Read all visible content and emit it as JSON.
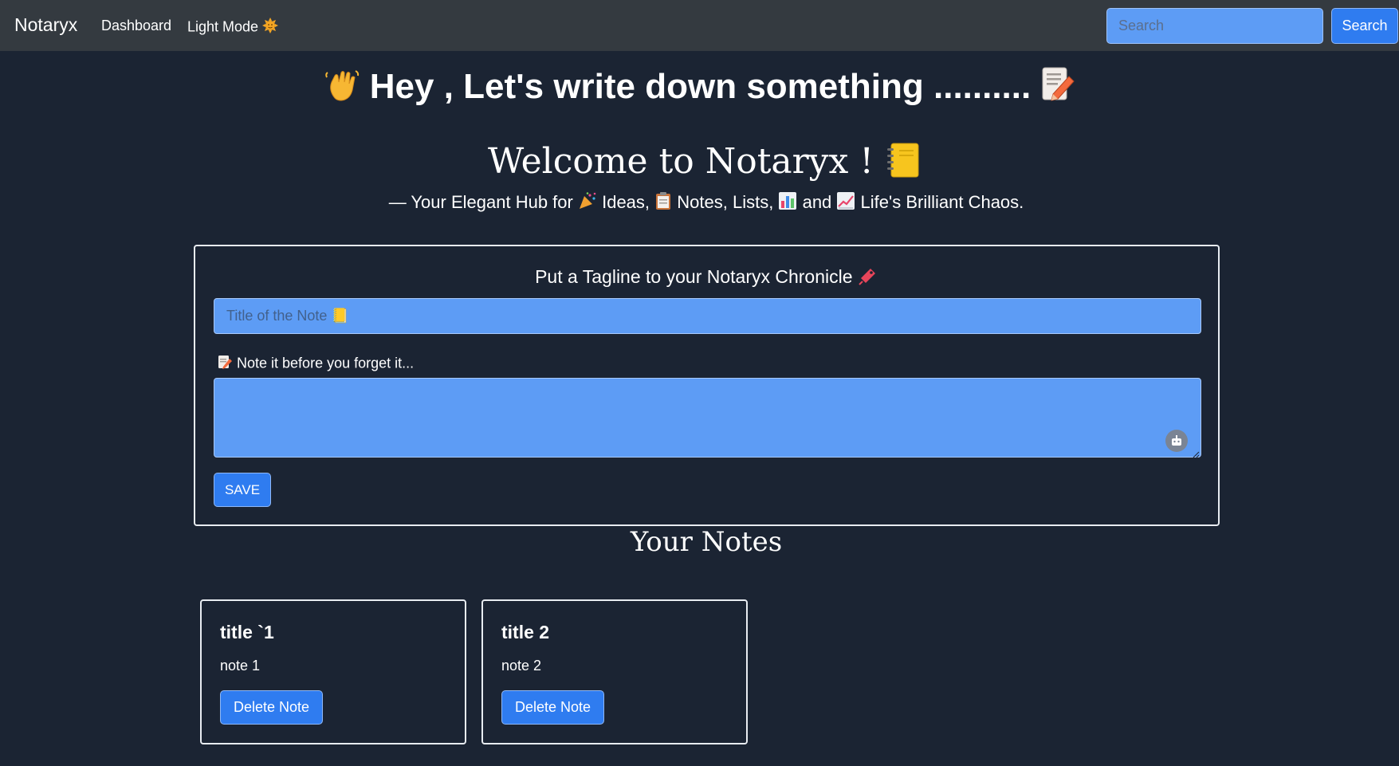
{
  "navbar": {
    "brand": "Notaryx",
    "links": [
      "Dashboard",
      "Light Mode"
    ],
    "lightmode_icon": "sun-face-icon",
    "search_placeholder": "Search",
    "search_button": "Search"
  },
  "hero": {
    "wave_icon": "waving-hand-icon",
    "text": "Hey , Let's write down something ..........",
    "memo_icon": "memo-pencil-icon"
  },
  "welcome": {
    "text": "Welcome to Notaryx !",
    "icon": "notebook-icon"
  },
  "subtitle": {
    "prefix": "— Your Elegant Hub for",
    "ideas": "Ideas,",
    "notes_lists": "Notes, Lists,",
    "and": "and",
    "chaos": "Life's Brilliant Chaos.",
    "icons": [
      "party-popper-icon",
      "clipboard-icon",
      "bar-chart-icon",
      "trend-chart-icon"
    ]
  },
  "form": {
    "tagline": "Put a Tagline to your Notaryx Chronicle",
    "tagline_icon": "ticket-icon",
    "title_placeholder": "Title of the Note 📒",
    "note_label": "Note it before you forget it...",
    "note_label_icon": "memo-icon",
    "assistant_icon": "bot-icon",
    "save_button": "SAVE"
  },
  "notes_section": {
    "heading": "Your Notes",
    "delete_label": "Delete Note",
    "notes": [
      {
        "title": "title `1",
        "body": "note 1"
      },
      {
        "title": "title 2",
        "body": "note 2"
      }
    ]
  },
  "colors": {
    "background": "#1b2433",
    "navbar": "#343a40",
    "input_fill": "#5d9cf5",
    "button": "#2f7cf0"
  }
}
